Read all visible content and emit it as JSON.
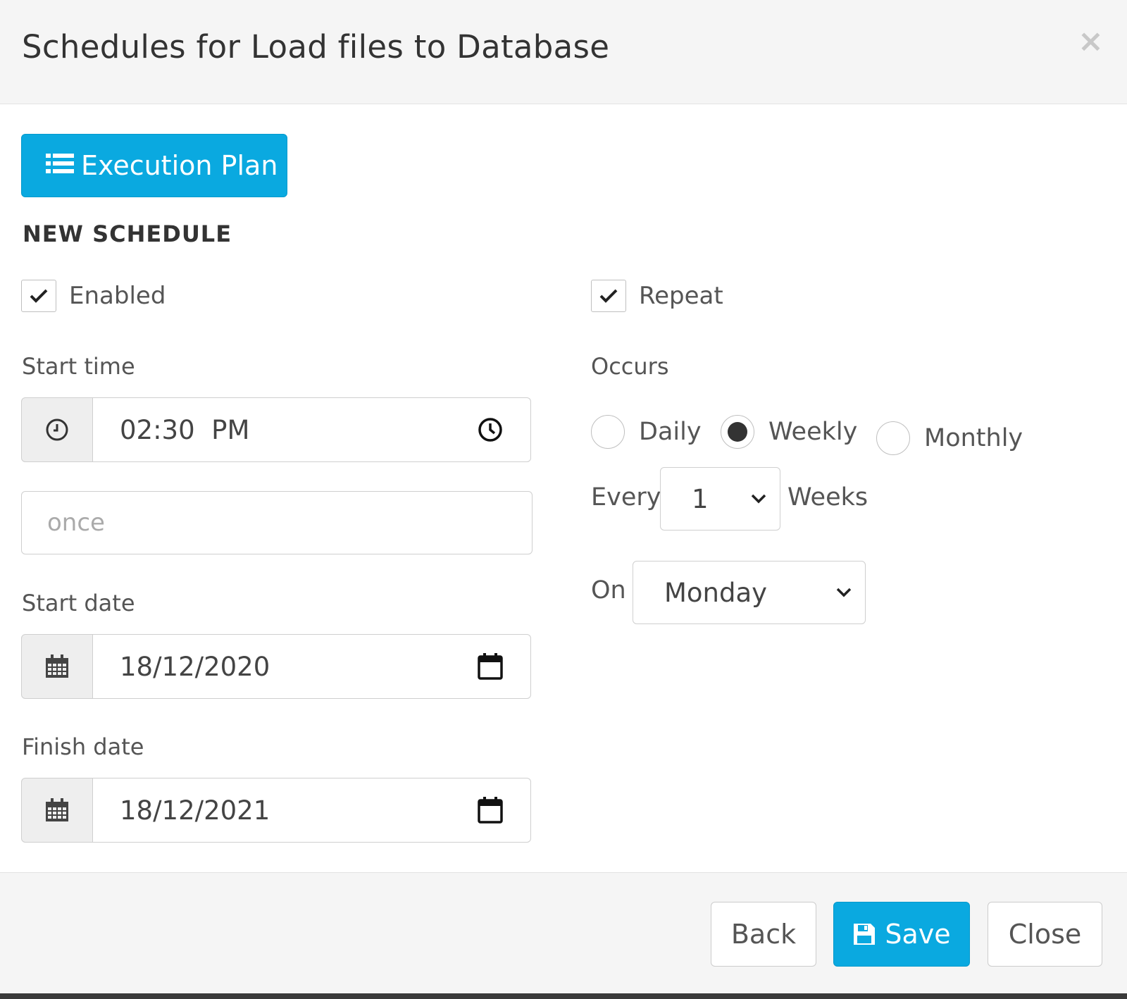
{
  "header": {
    "title": "Schedules for Load files to Database",
    "close_glyph": "×"
  },
  "toolbar": {
    "execution_plan_label": "Execution Plan",
    "execution_plan_icon": "list-icon"
  },
  "form": {
    "section_title": "NEW SCHEDULE",
    "enabled": {
      "label": "Enabled",
      "checked": true
    },
    "repeat": {
      "label": "Repeat",
      "checked": true
    },
    "start_time": {
      "label": "Start time",
      "value": "02:30  PM",
      "addon_icon": "clock-icon",
      "picker_icon": "clock-icon"
    },
    "frequency": {
      "placeholder": "once"
    },
    "start_date": {
      "label": "Start date",
      "value": "18/12/2020",
      "addon_icon": "calendar-icon",
      "picker_icon": "calendar-icon"
    },
    "finish_date": {
      "label": "Finish date",
      "value": "18/12/2021",
      "addon_icon": "calendar-icon",
      "picker_icon": "calendar-icon"
    },
    "occurs": {
      "label": "Occurs",
      "options": [
        "Daily",
        "Weekly",
        "Monthly"
      ],
      "selected": "Weekly"
    },
    "every": {
      "label": "Every",
      "value": "1",
      "unit": "Weeks"
    },
    "on": {
      "label": "On",
      "value": "Monday"
    }
  },
  "footer": {
    "back_label": "Back",
    "save_label": "Save",
    "close_label": "Close"
  },
  "colors": {
    "primary": "#0aa9e0",
    "header_bg": "#f5f5f5",
    "addon_bg": "#eeeeee"
  }
}
